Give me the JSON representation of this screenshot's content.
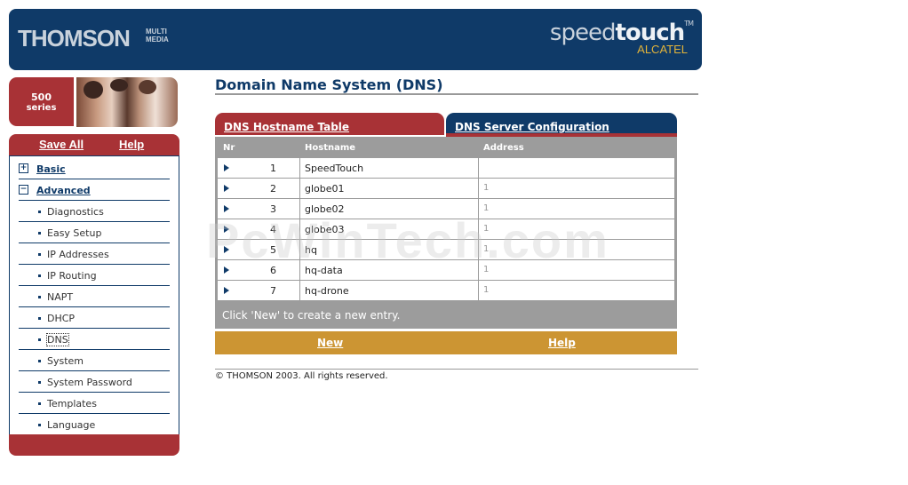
{
  "header": {
    "brand": "THOMSON",
    "brand_sub": "MULTI MEDIA",
    "product_a": "speed",
    "product_b": "touch",
    "trademark": "TM",
    "maker": "ALCATEL"
  },
  "badge": {
    "number": "500",
    "label": "series"
  },
  "sidebar": {
    "save_all": "Save All",
    "help": "Help",
    "items": [
      {
        "label": "Basic",
        "type": "group",
        "icon": "plus-icon",
        "expanded": false
      },
      {
        "label": "Advanced",
        "type": "group",
        "icon": "minus-icon",
        "expanded": true
      },
      {
        "label": "Diagnostics",
        "type": "sub"
      },
      {
        "label": "Easy Setup",
        "type": "sub"
      },
      {
        "label": "IP Addresses",
        "type": "sub"
      },
      {
        "label": "IP Routing",
        "type": "sub"
      },
      {
        "label": "NAPT",
        "type": "sub"
      },
      {
        "label": "DHCP",
        "type": "sub"
      },
      {
        "label": "DNS",
        "type": "sub",
        "selected": true
      },
      {
        "label": "System",
        "type": "sub"
      },
      {
        "label": "System Password",
        "type": "sub"
      },
      {
        "label": "Templates",
        "type": "sub"
      },
      {
        "label": "Language",
        "type": "sub"
      }
    ]
  },
  "page": {
    "title": "Domain Name System (DNS)",
    "tabs": [
      {
        "label": "DNS Hostname Table",
        "active": true
      },
      {
        "label": "DNS Server Configuration",
        "active": false
      }
    ],
    "table": {
      "columns": [
        "Nr",
        "Hostname",
        "Address"
      ],
      "rows": [
        {
          "nr": "1",
          "hostname": "SpeedTouch",
          "address": ""
        },
        {
          "nr": "2",
          "hostname": "globe01",
          "address": "1"
        },
        {
          "nr": "3",
          "hostname": "globe02",
          "address": "1"
        },
        {
          "nr": "4",
          "hostname": "globe03",
          "address": "1"
        },
        {
          "nr": "5",
          "hostname": "hq",
          "address": "1"
        },
        {
          "nr": "6",
          "hostname": "hq-data",
          "address": "1"
        },
        {
          "nr": "7",
          "hostname": "hq-drone",
          "address": "1"
        }
      ],
      "hint": "Click 'New' to create a new entry."
    },
    "actions": {
      "new": "New",
      "help": "Help"
    },
    "copyright": "© THOMSON 2003. All rights reserved."
  },
  "watermark": "PcWinTech.com",
  "colors": {
    "navy": "#0f3a68",
    "red": "#a83236",
    "gold": "#cc9533",
    "grey": "#9c9c9c"
  }
}
